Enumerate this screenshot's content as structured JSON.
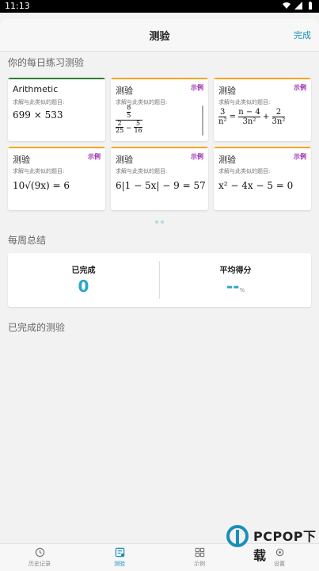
{
  "status_bar": {
    "time": "11:13"
  },
  "header": {
    "title": "测验",
    "done_label": "完成"
  },
  "practice": {
    "section_title": "你的每日练习测验",
    "hint_text": "求解与此类似的题目:",
    "cards": [
      {
        "title": "Arithmetic",
        "badge": "",
        "accent": "#2e7d32",
        "math": "699 × 533"
      },
      {
        "title": "测验",
        "badge": "示例",
        "accent": "#f5a623",
        "math": "(8/5)/(2/25 − 5/16)"
      },
      {
        "title": "测验",
        "badge": "示例",
        "accent": "#f5a623",
        "math": "3/n² = (n − 4)/(3n²) + 2/(3n²)"
      },
      {
        "title": "测验",
        "badge": "示例",
        "accent": "#f5a623",
        "math": "10√(9x) = 6"
      },
      {
        "title": "测验",
        "badge": "示例",
        "accent": "#f5a623",
        "math": "6|1 − 5x| − 9 = 57"
      },
      {
        "title": "测验",
        "badge": "示例",
        "accent": "#f5a623",
        "math": "x² − 4x − 5 = 0"
      }
    ]
  },
  "weekly": {
    "section_title": "每周总结",
    "completed_label": "已完成",
    "completed_value": "0",
    "average_label": "平均得分",
    "average_value": "--",
    "average_unit": "%"
  },
  "completed_section": {
    "title": "已完成的测验"
  },
  "tabs": [
    {
      "label": "历史记录",
      "icon": "history-icon",
      "active": false
    },
    {
      "label": "测验",
      "icon": "quiz-icon",
      "active": true
    },
    {
      "label": "示例",
      "icon": "grid-icon",
      "active": false
    },
    {
      "label": "设置",
      "icon": "gear-icon",
      "active": false
    }
  ],
  "watermark": {
    "text": "PCPOP下载",
    "sub": ""
  },
  "colors": {
    "accent": "#1a8fb8",
    "stat": "#27a7c8",
    "badge": "#9b27b0",
    "arithmetic_bar": "#2e7d32",
    "example_bar": "#f5a623"
  }
}
